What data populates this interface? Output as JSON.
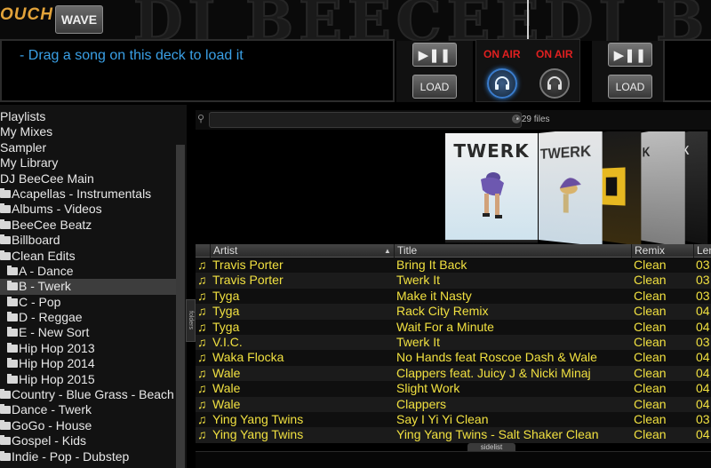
{
  "topbar": {
    "logo_text": "OUCH",
    "wave_label": "WAVE",
    "watermark_left": "DJ BEECEE",
    "watermark_right": "DJ B"
  },
  "deck_left": {
    "hint": "- Drag a song on this deck to load it",
    "play_label": "▶❚❚",
    "load_label": "LOAD"
  },
  "deck_right": {
    "play_label": "▶❚❚",
    "load_label": "LOAD"
  },
  "mixer": {
    "onair_left": "ON AIR",
    "onair_right": "ON AIR",
    "headphone_left_icon": "headphones-icon",
    "headphone_right_icon": "headphones-icon",
    "colors": {
      "onair": "#e02020",
      "active_headphone": "#3a7ccc"
    }
  },
  "sidebar": {
    "items": [
      {
        "label": "Playlists",
        "folder": false,
        "level": 1
      },
      {
        "label": "My Mixes",
        "folder": false,
        "level": 1
      },
      {
        "label": "Sampler",
        "folder": false,
        "level": 1
      },
      {
        "label": "My Library",
        "folder": false,
        "level": 1
      },
      {
        "label": "DJ BeeCee Main",
        "folder": false,
        "level": 1
      },
      {
        "label": "Acapellas - Instrumentals",
        "folder": true,
        "level": 2
      },
      {
        "label": "Albums - Videos",
        "folder": true,
        "level": 2
      },
      {
        "label": "BeeCee Beatz",
        "folder": true,
        "level": 2
      },
      {
        "label": "Billboard",
        "folder": true,
        "level": 2
      },
      {
        "label": "Clean Edits",
        "folder": true,
        "level": 2
      },
      {
        "label": "A - Dance",
        "folder": true,
        "level": 3
      },
      {
        "label": "B - Twerk",
        "folder": true,
        "level": 3,
        "selected": true
      },
      {
        "label": "C - Pop",
        "folder": true,
        "level": 3
      },
      {
        "label": "D - Reggae",
        "folder": true,
        "level": 3
      },
      {
        "label": "E - New Sort",
        "folder": true,
        "level": 3
      },
      {
        "label": "Hip Hop 2013",
        "folder": true,
        "level": 3
      },
      {
        "label": "Hip Hop 2014",
        "folder": true,
        "level": 3
      },
      {
        "label": "Hip Hop 2015",
        "folder": true,
        "level": 3
      },
      {
        "label": "Country - Blue Grass - Beach",
        "folder": true,
        "level": 2
      },
      {
        "label": "Dance - Twerk",
        "folder": true,
        "level": 2
      },
      {
        "label": "GoGo - House",
        "folder": true,
        "level": 2
      },
      {
        "label": "Gospel - Kids",
        "folder": true,
        "level": 2
      },
      {
        "label": "Indie - Pop - Dubstep",
        "folder": true,
        "level": 2
      }
    ],
    "folders_tab": "folders"
  },
  "browser": {
    "search_icon": "search-icon",
    "search_value": "",
    "search_placeholder": "",
    "files_count": "29 files",
    "covers": {
      "main_title": "TWERK",
      "second_title": "TWERK",
      "fourth_title": "K",
      "fifth_title": "K"
    }
  },
  "table": {
    "headers": {
      "artist": "Artist",
      "title": "Title",
      "remix": "Remix",
      "length": "Len"
    },
    "rows": [
      {
        "artist": "Travis Porter",
        "title": "Bring It Back",
        "remix": "Clean",
        "length": "03"
      },
      {
        "artist": "Travis Porter",
        "title": "Twerk It",
        "remix": "Clean",
        "length": "03"
      },
      {
        "artist": "Tyga",
        "title": "Make it Nasty",
        "remix": "Clean",
        "length": "03"
      },
      {
        "artist": "Tyga",
        "title": "Rack City Remix",
        "remix": "Clean",
        "length": "04"
      },
      {
        "artist": "Tyga",
        "title": "Wait For a Minute",
        "remix": "Clean",
        "length": "04"
      },
      {
        "artist": "V.I.C.",
        "title": "Twerk It",
        "remix": "Clean",
        "length": "03"
      },
      {
        "artist": "Waka Flocka",
        "title": "No Hands feat Roscoe Dash & Wale",
        "remix": "Clean",
        "length": "04"
      },
      {
        "artist": "Wale",
        "title": "Clappers feat. Juicy J & Nicki Minaj",
        "remix": "Clean",
        "length": "04"
      },
      {
        "artist": "Wale",
        "title": "Slight Work",
        "remix": "Clean",
        "length": "04"
      },
      {
        "artist": "Wale",
        "title": "Clappers",
        "remix": "Clean",
        "length": "04"
      },
      {
        "artist": "Ying Yang Twins",
        "title": "Say I Yi Yi Clean",
        "remix": "Clean",
        "length": "03"
      },
      {
        "artist": "Ying Yang Twins",
        "title": "Ying Yang Twins - Salt Shaker Clean",
        "remix": "Clean",
        "length": "04"
      }
    ],
    "sidelist_tab": "sidelist",
    "colors": {
      "row_text": "#f0e040"
    }
  }
}
